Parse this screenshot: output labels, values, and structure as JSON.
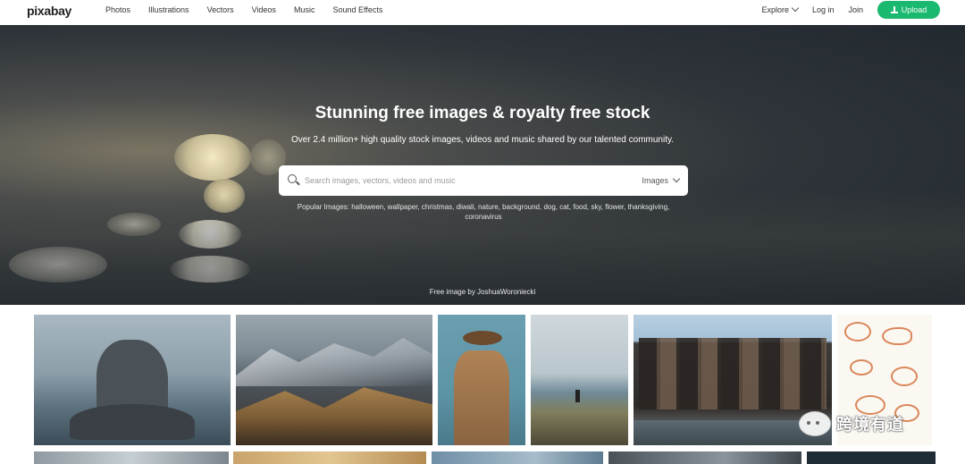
{
  "header": {
    "logo": "pixabay",
    "nav": [
      "Photos",
      "Illustrations",
      "Vectors",
      "Videos",
      "Music",
      "Sound Effects"
    ],
    "explore": "Explore",
    "login": "Log in",
    "join": "Join",
    "upload": "Upload",
    "brand_color": "#19b96f"
  },
  "hero": {
    "title": "Stunning free images & royalty free stock",
    "subtitle": "Over 2.4 million+ high quality stock images, videos and music shared by our talented community.",
    "search_placeholder": "Search images, vectors, videos and music",
    "search_type": "Images",
    "popular": "Popular Images: halloween, wallpaper, christmas, diwali, nature, background, dog, cat, food, sky, flower, thanksgiving, coronavirus",
    "credit": "Free image by JoshuaWoroniecki"
  },
  "watermark": {
    "text": "跨境有道"
  }
}
